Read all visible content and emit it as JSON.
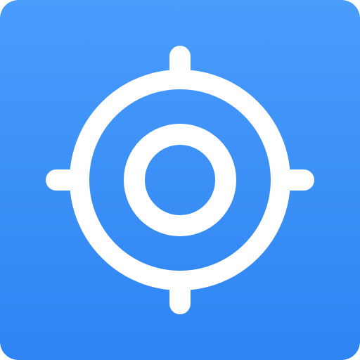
{
  "icon": {
    "name": "locate-crosshair-icon",
    "colors": {
      "background_top": "#4A9CFB",
      "background_bottom": "#2D84F2",
      "foreground": "#FFFFFF"
    }
  }
}
